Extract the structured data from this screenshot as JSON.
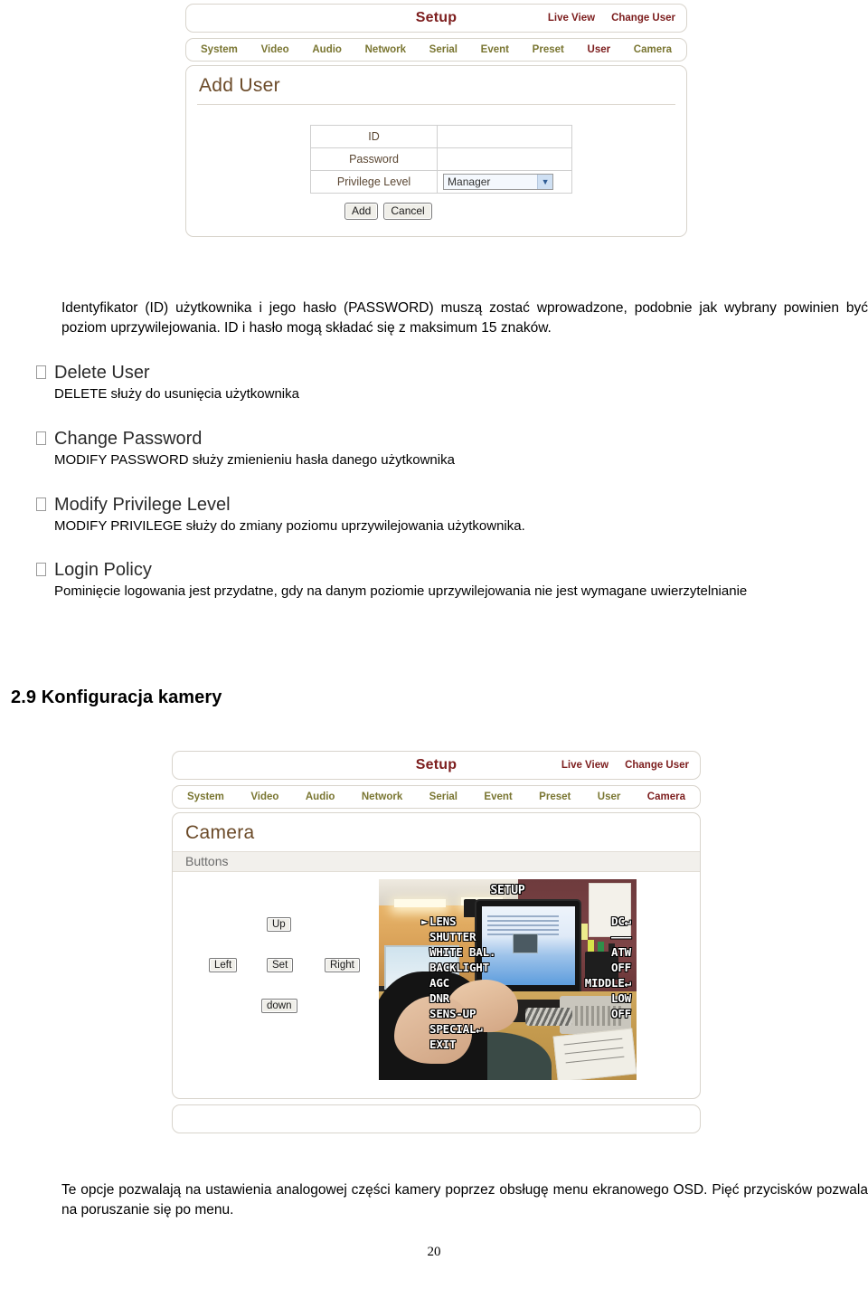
{
  "figure_add_user": {
    "titlebar": {
      "setup": "Setup",
      "live_view": "Live View",
      "change_user": "Change User"
    },
    "tabs": [
      {
        "label": "System",
        "active": false
      },
      {
        "label": "Video",
        "active": false
      },
      {
        "label": "Audio",
        "active": false
      },
      {
        "label": "Network",
        "active": false
      },
      {
        "label": "Serial",
        "active": false
      },
      {
        "label": "Event",
        "active": false
      },
      {
        "label": "Preset",
        "active": false
      },
      {
        "label": "User",
        "active": true
      },
      {
        "label": "Camera",
        "active": false
      }
    ],
    "section_title": "Add User",
    "form": {
      "rows": [
        {
          "label": "ID",
          "value": ""
        },
        {
          "label": "Password",
          "value": ""
        },
        {
          "label": "Privilege Level",
          "value": "Manager"
        }
      ],
      "privilege_selected": "Manager",
      "add_button": "Add",
      "cancel_button": "Cancel"
    }
  },
  "body_text": {
    "intro": "Identyfikator (ID) użytkownika i jego hasło (PASSWORD) muszą zostać wprowadzone, podobnie jak wybrany powinien być poziom uprzywilejowania. ID i hasło mogą składać się z maksimum 15 znaków.",
    "bullets": [
      {
        "heading": "Delete User",
        "text": "DELETE służy do usunięcia użytkownika"
      },
      {
        "heading": "Change Password",
        "text": "MODIFY PASSWORD służy zmienieniu hasła danego użytkownika"
      },
      {
        "heading": "Modify Privilege Level",
        "text": "MODIFY PRIVILEGE służy do zmiany poziomu uprzywilejowania użytkownika."
      },
      {
        "heading": "Login Policy",
        "text": "Pominięcie logowania jest przydatne, gdy na danym poziomie uprzywilejowania nie jest wymagane uwierzytelnianie"
      }
    ]
  },
  "section_heading": "2.9 Konfiguracja kamery",
  "figure_camera": {
    "titlebar": {
      "setup": "Setup",
      "live_view": "Live View",
      "change_user": "Change User"
    },
    "tabs": [
      {
        "label": "System",
        "active": false
      },
      {
        "label": "Video",
        "active": false
      },
      {
        "label": "Audio",
        "active": false
      },
      {
        "label": "Network",
        "active": false
      },
      {
        "label": "Serial",
        "active": false
      },
      {
        "label": "Event",
        "active": false
      },
      {
        "label": "Preset",
        "active": false
      },
      {
        "label": "User",
        "active": false
      },
      {
        "label": "Camera",
        "active": true
      }
    ],
    "section_title": "Camera",
    "buttons_label": "Buttons",
    "dpad": {
      "up": "Up",
      "left": "Left",
      "set": "Set",
      "right": "Right",
      "down": "down"
    },
    "osd": {
      "title": "SETUP",
      "rows": [
        {
          "label": "LENS",
          "value": "DC↵",
          "selected": true
        },
        {
          "label": "SHUTTER",
          "value": "———",
          "selected": false
        },
        {
          "label": "WHITE BAL.",
          "value": "ATW",
          "selected": false
        },
        {
          "label": "BACKLIGHT",
          "value": "OFF",
          "selected": false
        },
        {
          "label": "AGC",
          "value": "MIDDLE↵",
          "selected": false
        },
        {
          "label": "DNR",
          "value": "LOW",
          "selected": false
        },
        {
          "label": "SENS-UP",
          "value": "OFF",
          "selected": false
        },
        {
          "label": "SPECIAL↵",
          "value": "",
          "selected": false
        },
        {
          "label": "EXIT",
          "value": "",
          "selected": false
        }
      ]
    }
  },
  "caption": "Te opcje pozwalają na ustawienia analogowej części kamery poprzez obsługę menu ekranowego OSD. Pięć przycisków pozwala na poruszanie się po menu.",
  "page_number": "20",
  "colors": {
    "setup_red": "#7c1d1d",
    "tab_olive": "#7a7632",
    "section_brown": "#6b4a28",
    "panel_border": "#d8d4cc"
  }
}
